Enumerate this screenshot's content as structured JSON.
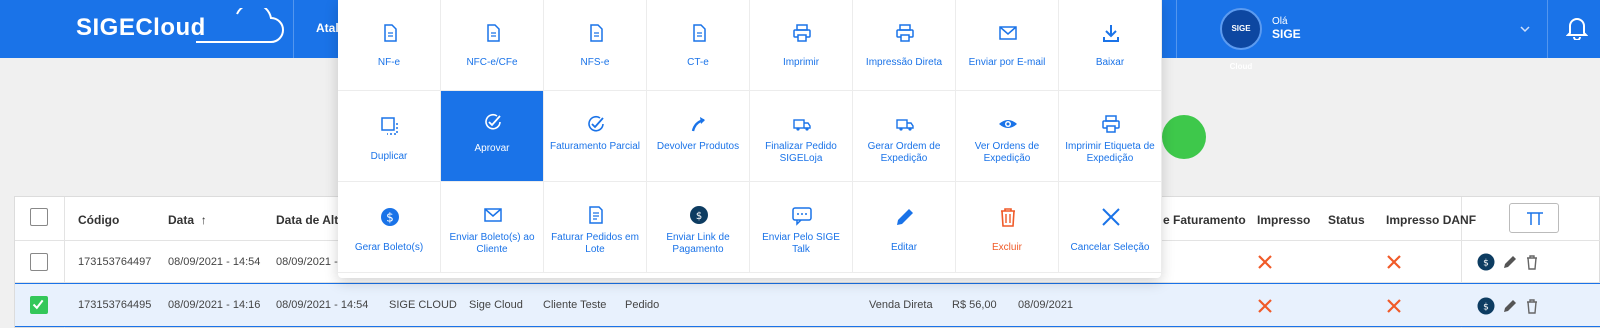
{
  "header": {
    "logo": "SIGECloud",
    "nav_partial": "Atalh",
    "user": {
      "avatar_text": "SIGE Cloud",
      "hello": "Olá",
      "name": "SIGE"
    }
  },
  "menu": {
    "rows": [
      [
        {
          "label": "NF-e",
          "icon": "document-icon"
        },
        {
          "label": "NFC-e/CFe",
          "icon": "document-icon"
        },
        {
          "label": "NFS-e",
          "icon": "document-icon"
        },
        {
          "label": "CT-e",
          "icon": "document-icon"
        },
        {
          "label": "Imprimir",
          "icon": "printer-icon"
        },
        {
          "label": "Impressão Direta",
          "icon": "printer-icon"
        },
        {
          "label": "Enviar por E-mail",
          "icon": "mail-icon"
        },
        {
          "label": "Baixar",
          "icon": "download-icon"
        }
      ],
      [
        {
          "label": "Duplicar",
          "icon": "duplicate-icon"
        },
        {
          "label": "Aprovar",
          "icon": "check-circle-icon"
        },
        {
          "label": "Faturamento Parcial",
          "icon": "check-circle-icon"
        },
        {
          "label": "Devolver Produtos",
          "icon": "return-arrow-icon"
        },
        {
          "label": "Finalizar Pedido SIGELoja",
          "icon": "truck-icon"
        },
        {
          "label": "Gerar Ordem de Expedição",
          "icon": "truck-icon"
        },
        {
          "label": "Ver Ordens de Expedição",
          "icon": "eye-icon"
        },
        {
          "label": "Imprimir Etiqueta de Expedição",
          "icon": "printer-icon"
        }
      ],
      [
        {
          "label": "Gerar Boleto(s)",
          "icon": "dollar-circle-icon"
        },
        {
          "label": "Enviar Boleto(s) ao Cliente",
          "icon": "mail-icon"
        },
        {
          "label": "Faturar Pedidos em Lote",
          "icon": "invoice-icon"
        },
        {
          "label": "Enviar Link de Pagamento",
          "icon": "payment-link-icon"
        },
        {
          "label": "Enviar Pelo SIGE Talk",
          "icon": "chat-icon"
        },
        {
          "label": "Editar",
          "icon": "pencil-icon"
        },
        {
          "label": "Excluir",
          "icon": "trash-icon"
        },
        {
          "label": "Cancelar Seleção",
          "icon": "close-icon"
        }
      ]
    ],
    "active_label": "Aprovar"
  },
  "table": {
    "headers": {
      "codigo": "Código",
      "data": "Data",
      "data_alter": "Data de Alter",
      "faturamento": "e Faturamento",
      "impresso": "Impresso",
      "status": "Status",
      "impresso_danf": "Impresso DANF"
    },
    "rows": [
      {
        "selected": false,
        "codigo": "173153764497",
        "data": "08/09/2021 - 14:54",
        "data_alter": "08/09/2021 -",
        "empresa": "",
        "vendedor": "",
        "cliente": "",
        "tipo": "",
        "forma": "",
        "valor": "",
        "fat": ""
      },
      {
        "selected": true,
        "codigo": "173153764495",
        "data": "08/09/2021 - 14:16",
        "data_alter": "08/09/2021 - 14:54",
        "empresa": "SIGE CLOUD",
        "vendedor": "Sige Cloud",
        "cliente": "Cliente Teste",
        "tipo": "Pedido",
        "forma": "Venda Direta",
        "valor": "R$  56,00",
        "fat": "08/09/2021"
      }
    ]
  },
  "colors": {
    "primary": "#1a73e8",
    "danger": "#f05a28",
    "success": "#34c759"
  }
}
